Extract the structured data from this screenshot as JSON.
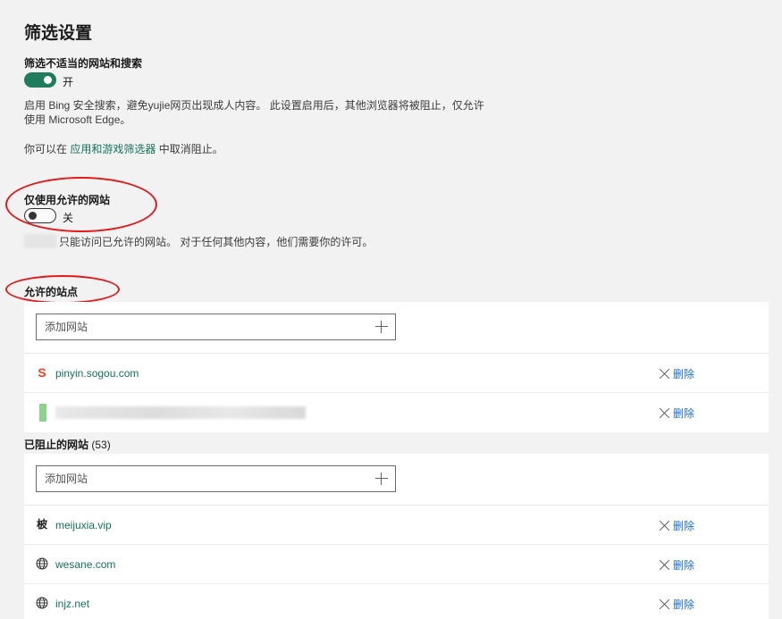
{
  "page_title": "筛选设置",
  "filter_section": {
    "heading": "筛选不适当的网站和搜索",
    "toggle_state": "开",
    "desc_line1": "启用 Bing 安全搜索，避免yujie网页出现成人内容。 此设置启用后，其他浏览器将被阻止，仅允许",
    "desc_line2": "使用 Microsoft Edge。",
    "unblock_prefix": "你可以在 ",
    "unblock_link": "应用和游戏筛选器",
    "unblock_suffix": " 中取消阻止。"
  },
  "allowed_only_section": {
    "heading": "仅使用允许的网站",
    "toggle_state": "关",
    "desc": "只能访问已允许的网站。 对于任何其他内容，他们需要你的许可。"
  },
  "allowed_sites": {
    "heading": "允许的站点",
    "add_placeholder": "添加网站",
    "items": [
      {
        "name": "pinyin.sogou.com",
        "icon": "sogou-icon",
        "delete_label": "删除"
      },
      {
        "name": "",
        "icon": "blurred-site-icon",
        "delete_label": "删除"
      }
    ]
  },
  "blocked_sites": {
    "heading": "已阻止的网站",
    "count": "(53)",
    "add_placeholder": "添加网站",
    "items": [
      {
        "name": "meijuxia.vip",
        "icon": "meijuxia-icon",
        "delete_label": "删除"
      },
      {
        "name": "wesane.com",
        "icon": "globe-icon",
        "delete_label": "删除"
      },
      {
        "name": "injz.net",
        "icon": "globe-icon",
        "delete_label": "删除"
      }
    ]
  },
  "colors": {
    "accent_green": "#217c5e",
    "link_green": "#14735a",
    "annotation_red": "#e11a1a",
    "delete_blue": "#1a6ed8"
  }
}
